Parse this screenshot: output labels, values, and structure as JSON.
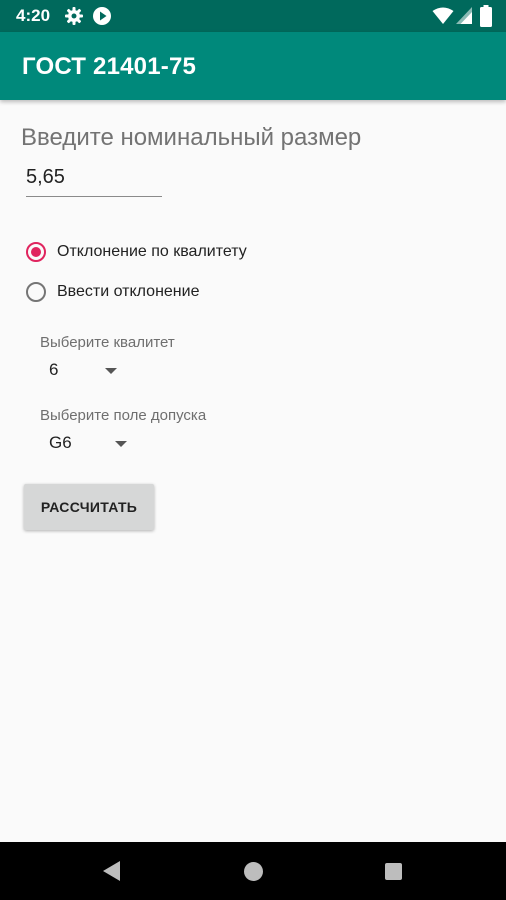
{
  "status_bar": {
    "time": "4:20",
    "left_icons": [
      "gear-icon",
      "play-circle-icon"
    ],
    "right_icons": [
      "wifi-icon",
      "signal-icon",
      "battery-icon"
    ]
  },
  "app_bar": {
    "title": "ГОСТ 21401-75",
    "color": "#00897b",
    "status_color": "#00695c"
  },
  "form": {
    "prompt": "Введите номинальный размер",
    "size_value": "5,65",
    "radio_options": [
      {
        "label": "Отклонение по квалитету",
        "checked": true
      },
      {
        "label": "Ввести отклонение",
        "checked": false
      }
    ],
    "quality": {
      "label": "Выберите квалитет",
      "value": "6"
    },
    "tolerance_field": {
      "label": "Выберите поле допуска",
      "value": "G6"
    },
    "calculate_button": "РАССЧИТАТЬ",
    "accent_color": "#e0245e"
  },
  "nav_bar": {
    "icons": [
      "back-icon",
      "home-icon",
      "recents-icon"
    ]
  }
}
